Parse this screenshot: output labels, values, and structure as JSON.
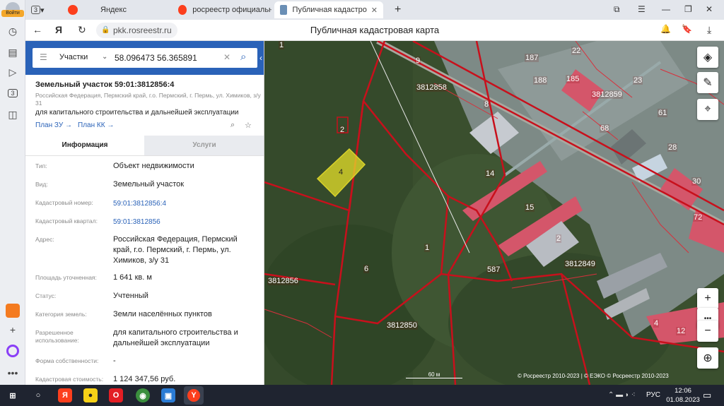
{
  "browser": {
    "login_label": "Войти",
    "tab_count": "3",
    "tabs": [
      {
        "label": "Яндекс"
      },
      {
        "label": "росреестр официальный"
      },
      {
        "label": "Публичная кадастровая карта"
      }
    ],
    "new_tab": "+",
    "url": "pkk.rosreestr.ru",
    "page_title": "Публичная кадастровая карта",
    "colors": {
      "accent": "#2a62b8",
      "yandex_red": "#fc3f1d"
    }
  },
  "panel": {
    "search_type": "Участки",
    "search_value": "58.096473 56.365891",
    "title": "Земельный участок 59:01:3812856:4",
    "address_line": "Российская Федерация, Пермский край, г.о. Пермский, г. Пермь, ул. Химиков, з/у 31",
    "purpose": "для капитального строительства и дальнейшей эксплуатации",
    "plan_zu": "План ЗУ →",
    "plan_kk": "План КК →",
    "tabs": {
      "info": "Информация",
      "services": "Услуги"
    },
    "rows": [
      {
        "label": "Тип:",
        "value": "Объект недвижимости"
      },
      {
        "label": "Вид:",
        "value": "Земельный участок"
      },
      {
        "label": "Кадастровый номер:",
        "value": "59:01:3812856:4"
      },
      {
        "label": "Кадастровый квартал:",
        "value": "59:01:3812856"
      },
      {
        "label": "Адрес:",
        "value": "Российская Федерация, Пермский край, г.о. Пермский, г. Пермь, ул. Химиков, з/у 31"
      },
      {
        "label": "Площадь уточненная:",
        "value": "1 641 кв. м"
      },
      {
        "label": "Статус:",
        "value": "Учтенный"
      },
      {
        "label": "Категория земель:",
        "value": "Земли населённых пунктов"
      },
      {
        "label": "Разрешенное использование:",
        "value": "для капитального строительства и дальнейшей эксплуатации"
      },
      {
        "label": "Форма собственности:",
        "value": "-"
      },
      {
        "label": "Кадастровая стоимость:",
        "value": "1 124 347,56 руб."
      }
    ]
  },
  "map": {
    "labels": {
      "q_3812858": "3812858",
      "q_3812859": "3812859",
      "q_3812856": "3812856",
      "q_3812850": "3812850",
      "q_3812849": "3812849",
      "p2": "2",
      "p4": "4",
      "p6": "6",
      "p1": "1",
      "p1b": "1",
      "p9": "9",
      "p8": "8",
      "p14": "14",
      "p15": "15",
      "p587": "587",
      "p187": "187",
      "p185": "185",
      "p22": "22",
      "p23": "23",
      "p61": "61",
      "p28": "28",
      "p68": "68",
      "p30": "30",
      "p72": "72",
      "p12": "12",
      "p2b": "2",
      "p4b": "4",
      "p188": "188"
    },
    "scale": "60 м",
    "attribution": "© Росреестр 2010-2023 | © ЕЭКО © Росреестр 2010-2023"
  },
  "taskbar": {
    "time": "12:06",
    "date": "01.08.2023",
    "lang": "РУС"
  }
}
